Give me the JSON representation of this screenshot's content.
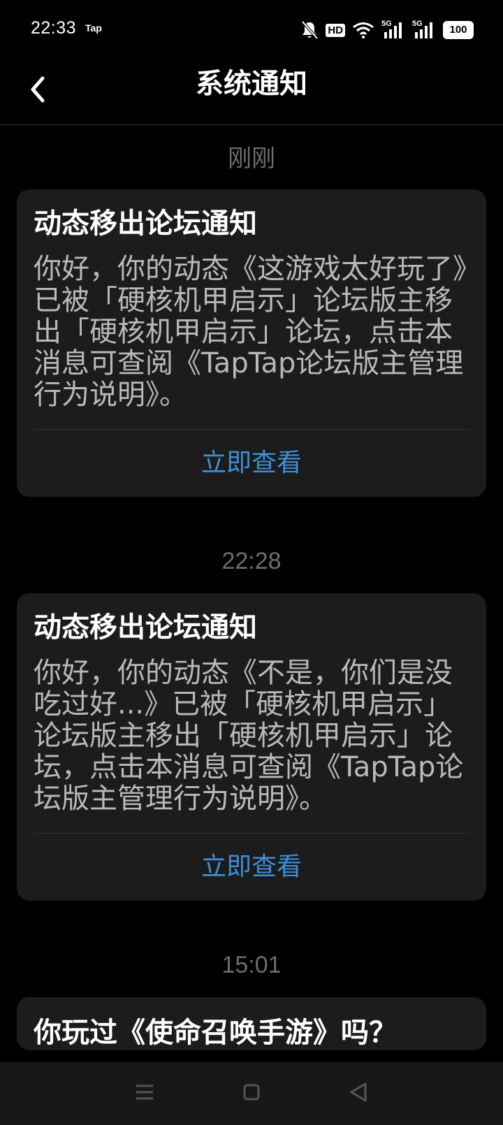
{
  "status_bar": {
    "time": "22:33",
    "app_label": "Tap",
    "hd_label": "HD",
    "signal_labels": [
      "5G",
      "5G"
    ],
    "battery": "100",
    "icons": [
      "bell-muted-icon",
      "hd-icon",
      "wifi-icon",
      "signal-5g-icon",
      "signal-5g-icon",
      "battery-icon"
    ]
  },
  "header": {
    "title": "系统通知",
    "back_icon": "chevron-left-icon"
  },
  "notifications": [
    {
      "time": "刚刚",
      "title": "动态移出论坛通知",
      "body": "你好，你的动态《这游戏太好玩了》已被「硬核机甲启示」论坛版主移出「硬核机甲启示」论坛，点击本消息可查阅《TapTap论坛版主管理行为说明》。",
      "action": "立即查看"
    },
    {
      "time": "22:28",
      "title": "动态移出论坛通知",
      "body": "你好，你的动态《不是，你们是没吃过好...》已被「硬核机甲启示」论坛版主移出「硬核机甲启示」论坛，点击本消息可查阅《TapTap论坛版主管理行为说明》。",
      "action": "立即查看"
    },
    {
      "time": "15:01",
      "title": "你玩过《使命召唤手游》吗？"
    }
  ],
  "nav_bar": {
    "icons": [
      "menu-icon",
      "home-square-icon",
      "back-triangle-icon"
    ]
  },
  "colors": {
    "background": "#000000",
    "card": "#1c1c1c",
    "accent_link": "#3d8fd8",
    "body_text": "#b9b9b9",
    "time_label": "#6d6d6d"
  }
}
